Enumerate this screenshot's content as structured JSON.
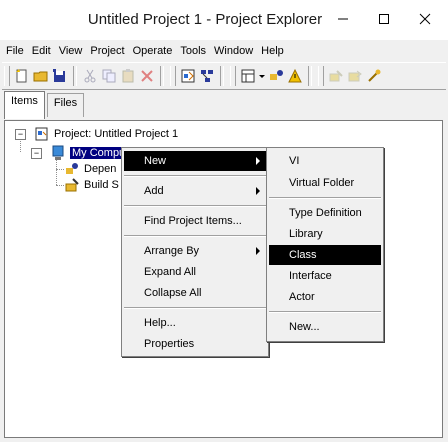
{
  "window": {
    "title": "Untitled Project 1 - Project Explorer",
    "minimize_icon": "minimize-icon",
    "maximize_icon": "maximize-icon",
    "close_icon": "close-icon"
  },
  "menubar": [
    "File",
    "Edit",
    "View",
    "Project",
    "Operate",
    "Tools",
    "Window",
    "Help"
  ],
  "tabs": [
    {
      "label": "Items",
      "active": true
    },
    {
      "label": "Files",
      "active": false
    }
  ],
  "tree": {
    "project_label": "Project: Untitled Project 1",
    "computer_label": "My Compu",
    "dependencies_label": "Depen",
    "build_label": "Build S"
  },
  "context_menu": {
    "items": [
      "New",
      "Add",
      "Find Project Items...",
      "Arrange By",
      "Expand All",
      "Collapse All",
      "Help...",
      "Properties"
    ]
  },
  "submenu": {
    "items": [
      "VI",
      "Virtual Folder",
      "Type Definition",
      "Library",
      "Class",
      "Interface",
      "Actor",
      "New..."
    ],
    "highlighted": "Class"
  },
  "colors": {
    "selection": "#000080",
    "menu_highlight": "#000000"
  }
}
